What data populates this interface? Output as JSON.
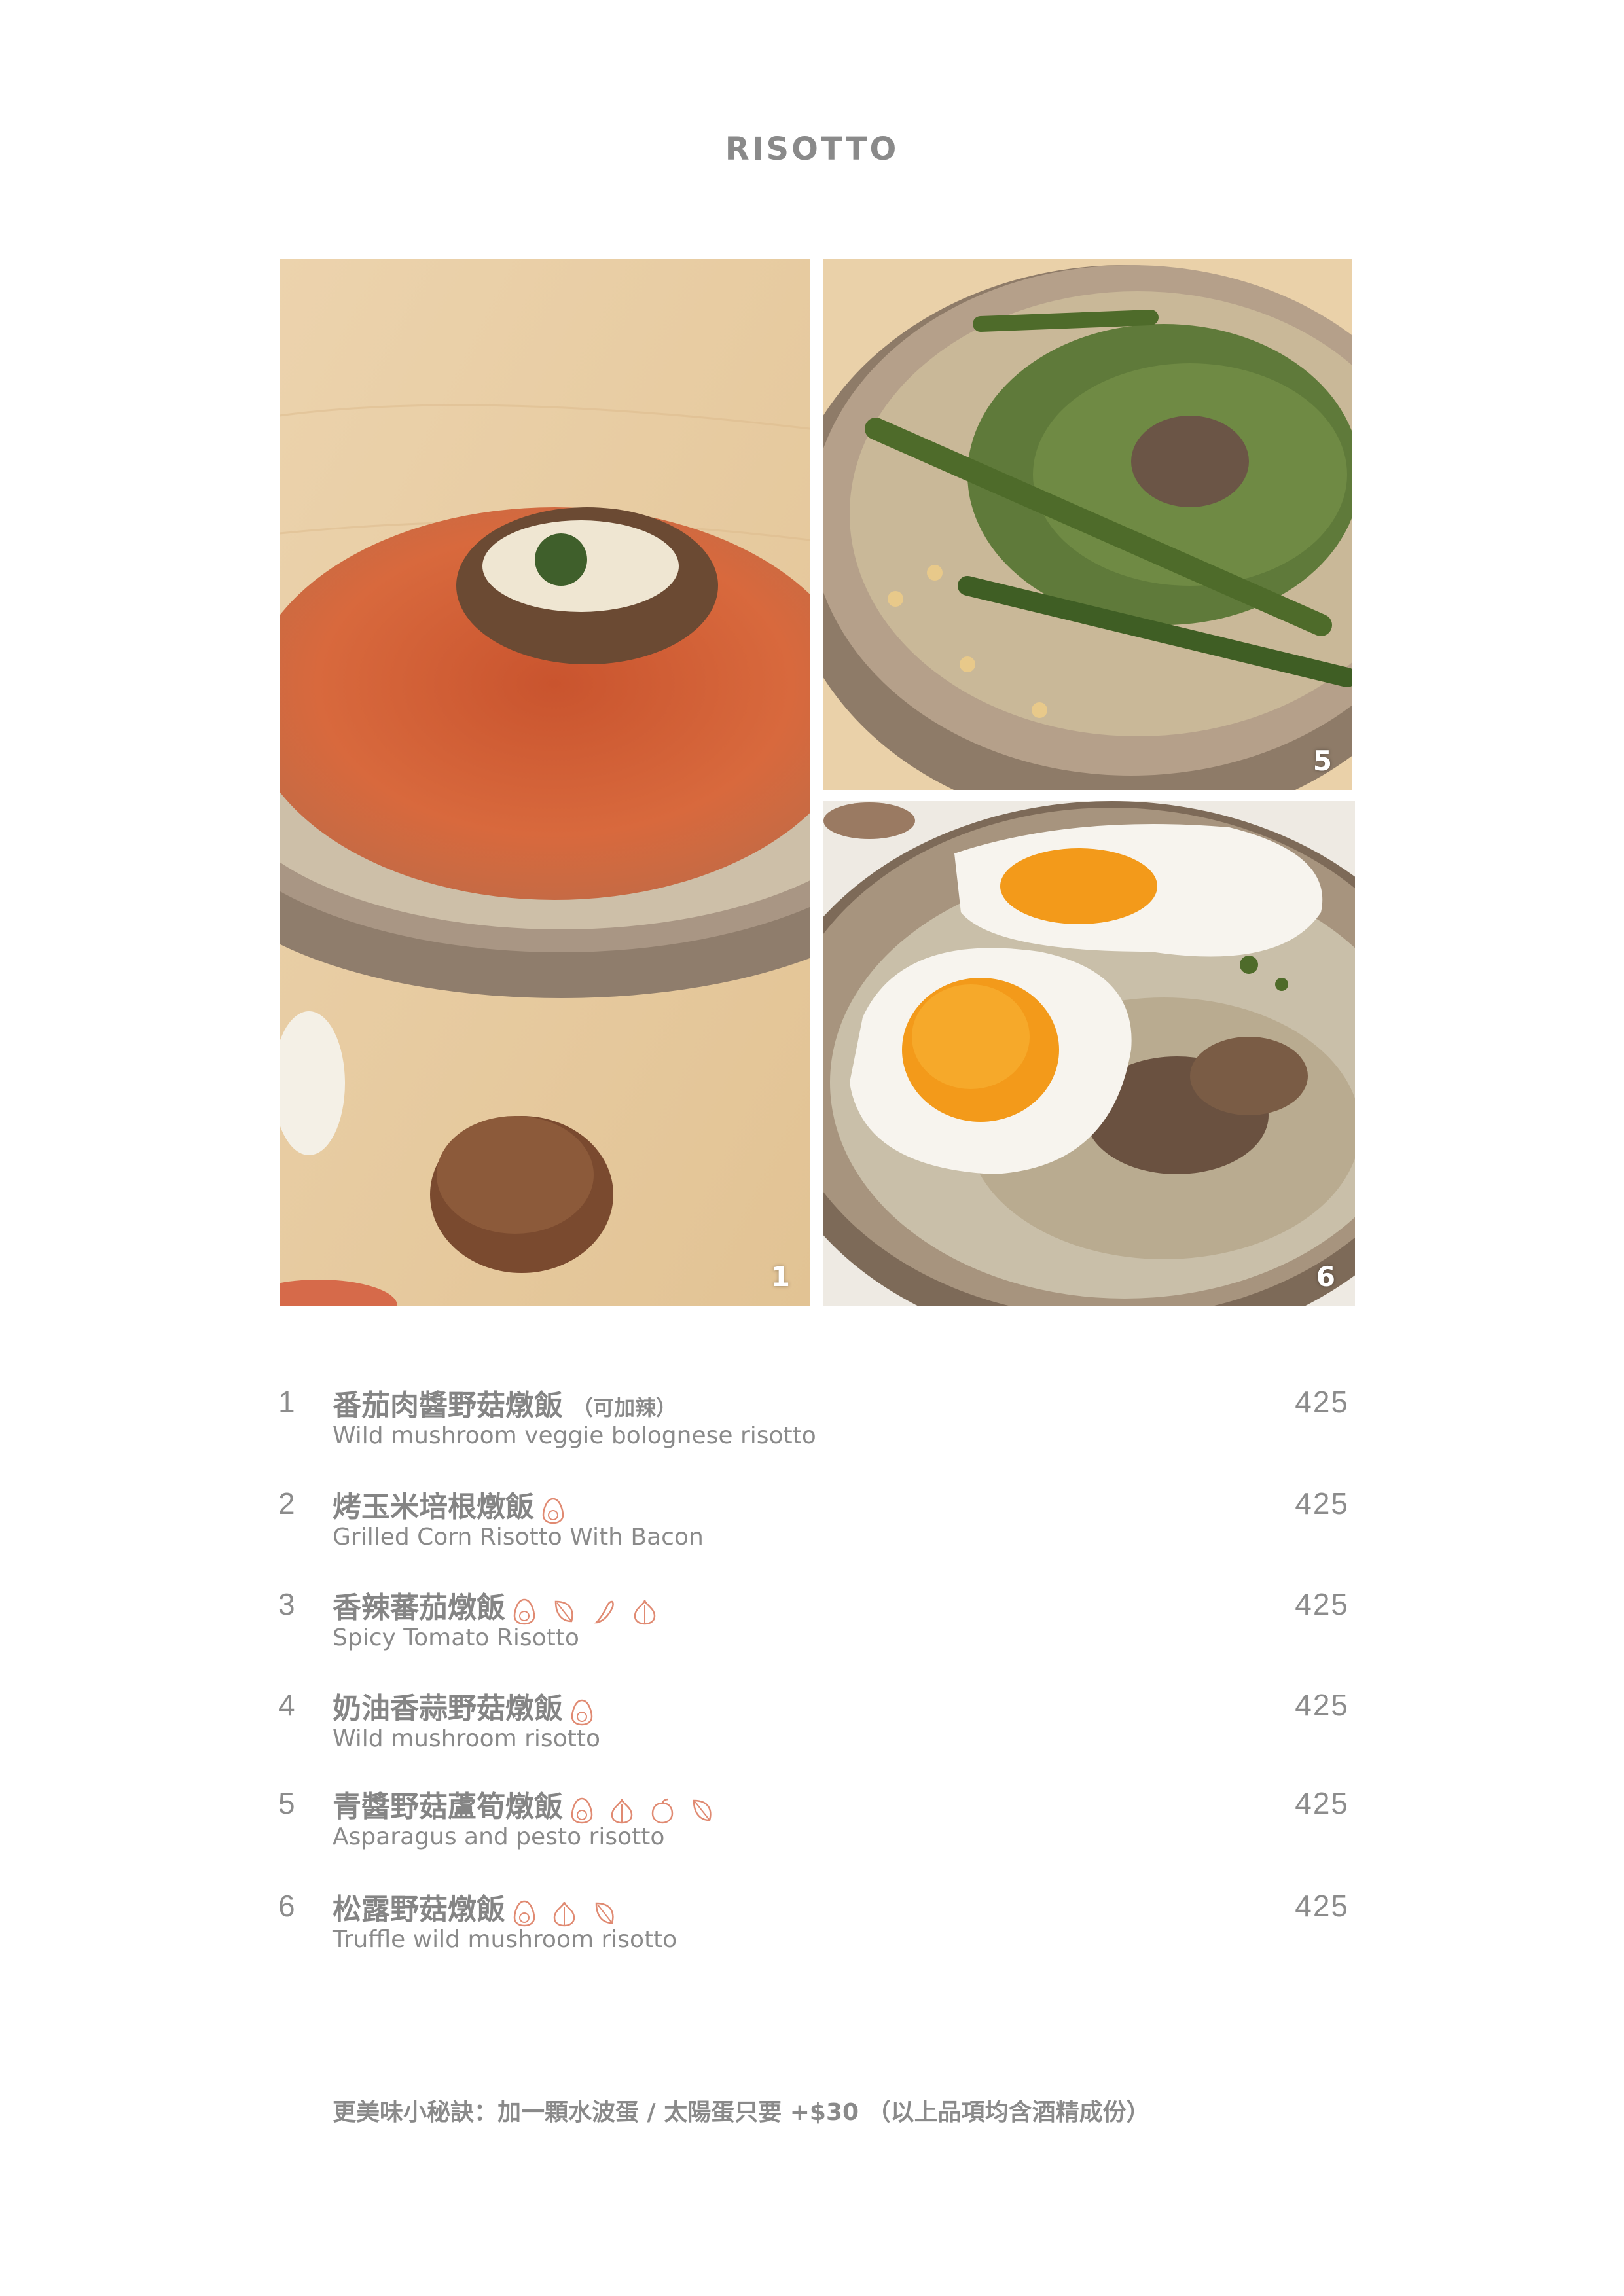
{
  "page": {
    "title": "RISOTTO"
  },
  "photos": [
    {
      "number": "1"
    },
    {
      "number": "5"
    },
    {
      "number": "6"
    }
  ],
  "colors": {
    "text": "#858585",
    "icon": "#e08a72",
    "wood": "#e9caa0",
    "plate": "#a08c78"
  },
  "items": [
    {
      "no": "1",
      "zh": "番茄肉醬野菇燉飯",
      "note": "（可加辣）",
      "en": "Wild mushroom veggie bolognese risotto",
      "price": "425",
      "icons": []
    },
    {
      "no": "2",
      "zh": "烤玉米培根燉飯",
      "en": "Grilled Corn Risotto With Bacon",
      "price": "425",
      "icons": [
        "egg-icon"
      ]
    },
    {
      "no": "3",
      "zh": "香辣蕃茄燉飯",
      "en": "Spicy Tomato Risotto",
      "price": "425",
      "icons": [
        "egg-icon",
        "leaf-icon",
        "chili-icon",
        "onion-icon"
      ]
    },
    {
      "no": "4",
      "zh": "奶油香蒜野菇燉飯",
      "en": "Wild mushroom risotto",
      "price": "425",
      "icons": [
        "egg-icon"
      ]
    },
    {
      "no": "5",
      "zh": "青醬野菇蘆筍燉飯",
      "en": "Asparagus and pesto risotto",
      "price": "425",
      "icons": [
        "egg-icon",
        "onion-icon",
        "nut-icon",
        "leaf-icon"
      ]
    },
    {
      "no": "6",
      "zh": "松露野菇燉飯",
      "en": "Truffle wild mushroom risotto",
      "price": "425",
      "icons": [
        "egg-icon",
        "onion-icon",
        "leaf-icon"
      ]
    }
  ],
  "footer": {
    "note": "更美味小秘訣：加一顆水波蛋 / 太陽蛋只要 +$30 （以上品項均含酒精成份）"
  }
}
